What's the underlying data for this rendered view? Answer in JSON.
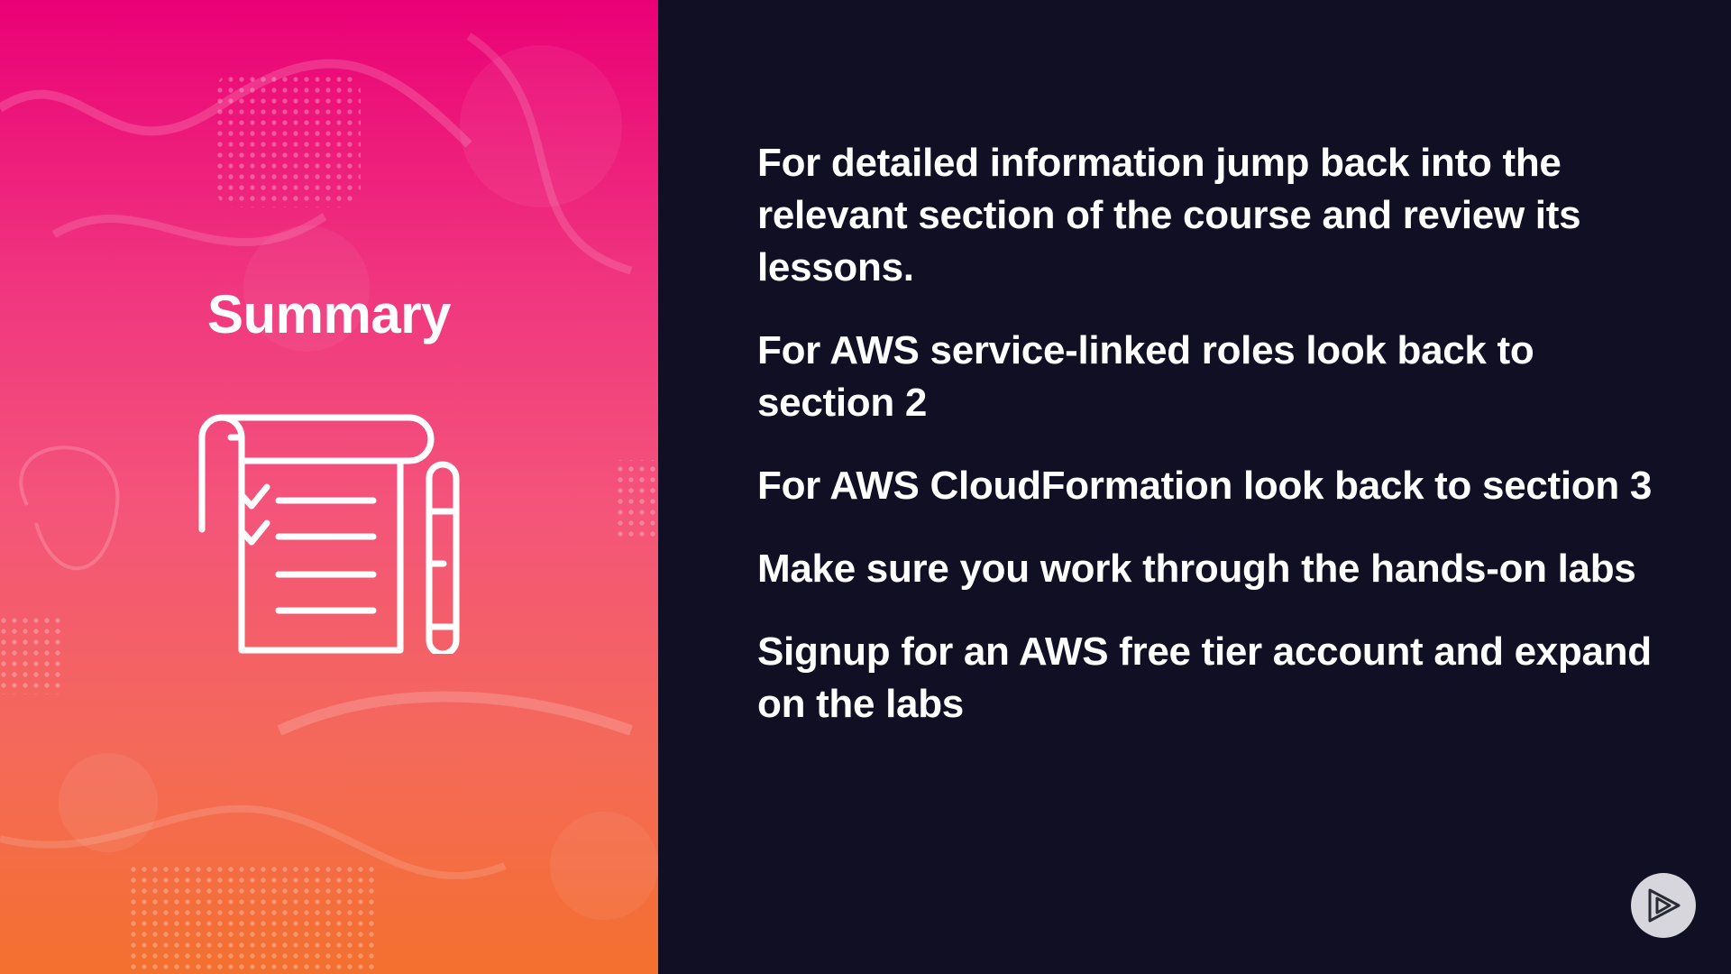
{
  "slide": {
    "title": "Summary",
    "icon": "checklist-notepad-with-pen-icon",
    "points": [
      "For detailed information jump back into the relevant section of the course and review its lessons.",
      "For AWS service-linked roles look back to section 2",
      "For AWS CloudFormation look back to section 3",
      "Make sure you work through the hands-on labs",
      "Signup for an AWS free tier account and expand on the labs"
    ]
  },
  "player": {
    "icon": "play-logo-icon"
  },
  "colors": {
    "panel_gradient_top": "#ea0076",
    "panel_gradient_bottom": "#f4702e",
    "dark_background": "#110f23",
    "text": "#ffffff",
    "badge": "#d6d6dc"
  }
}
